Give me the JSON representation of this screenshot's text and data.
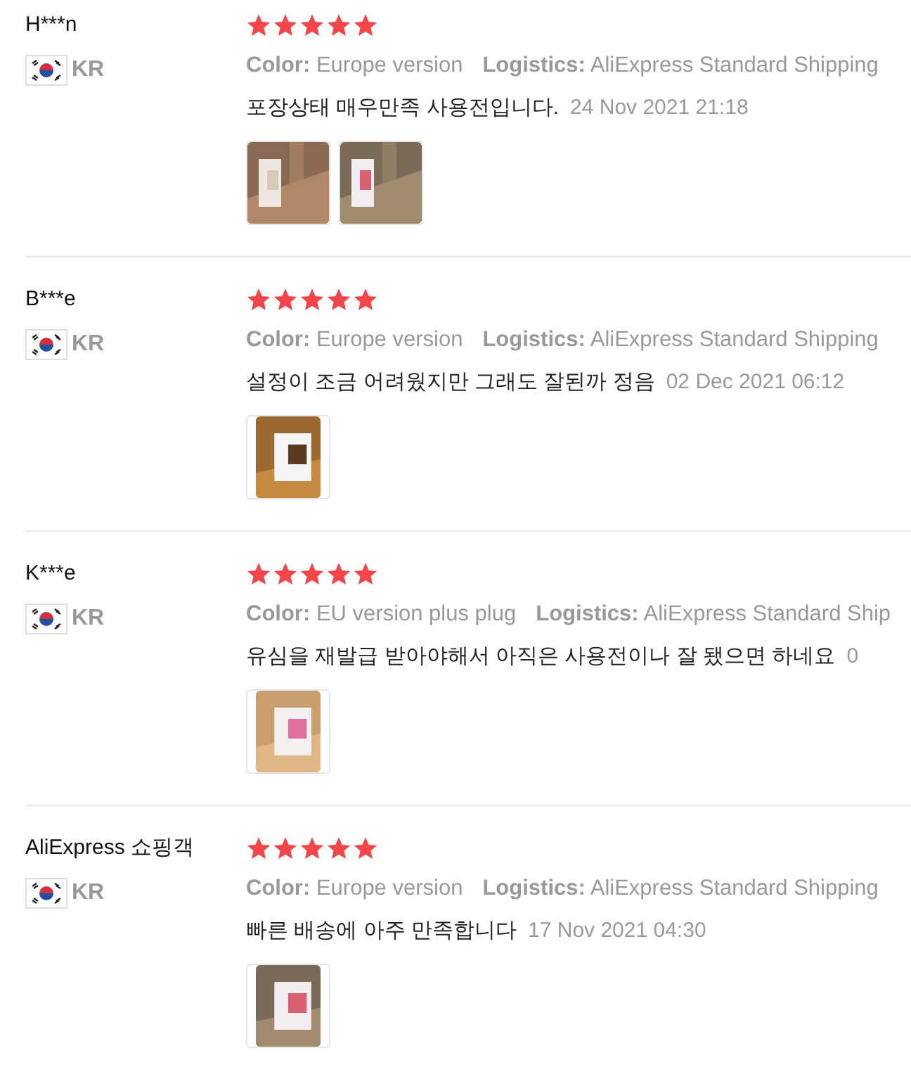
{
  "reviews": [
    {
      "name": "H***n",
      "country": "KR",
      "stars": 5,
      "attributes": [
        {
          "label": "Color:",
          "value": "Europe version"
        },
        {
          "label": "Logistics:",
          "value": "AliExpress Standard Shipping"
        }
      ],
      "text": "포장상태 매우만족 사용전입니다.",
      "date": "24 Nov 2021 21:18",
      "photos": [
        {
          "kind": "picture"
        },
        {
          "kind": "picture"
        }
      ]
    },
    {
      "name": "B***e",
      "country": "KR",
      "stars": 5,
      "attributes": [
        {
          "label": "Color:",
          "value": "Europe version"
        },
        {
          "label": "Logistics:",
          "value": "AliExpress Standard Shipping"
        }
      ],
      "text": "설정이 조금 어려웠지만 그래도 잘된까 정음",
      "date": "02 Dec 2021 06:12",
      "photos": [
        {
          "kind": "picture"
        }
      ]
    },
    {
      "name": "K***e",
      "country": "KR",
      "stars": 5,
      "attributes": [
        {
          "label": "Color:",
          "value": "EU version plus plug"
        },
        {
          "label": "Logistics:",
          "value": "AliExpress Standard Ship"
        }
      ],
      "text": "유심을 재발급 받아야해서 아직은 사용전이나 잘 됐으면 하네요",
      "date": "0",
      "photos": [
        {
          "kind": "picture"
        }
      ]
    },
    {
      "name": "AliExpress 쇼핑객",
      "country": "KR",
      "stars": 5,
      "attributes": [
        {
          "label": "Color:",
          "value": "Europe version"
        },
        {
          "label": "Logistics:",
          "value": "AliExpress Standard Shipping"
        }
      ],
      "text": "빠른 배송에 아주 만족합니다",
      "date": "17 Nov 2021 04:30",
      "photos": [
        {
          "kind": "picture"
        }
      ]
    }
  ]
}
